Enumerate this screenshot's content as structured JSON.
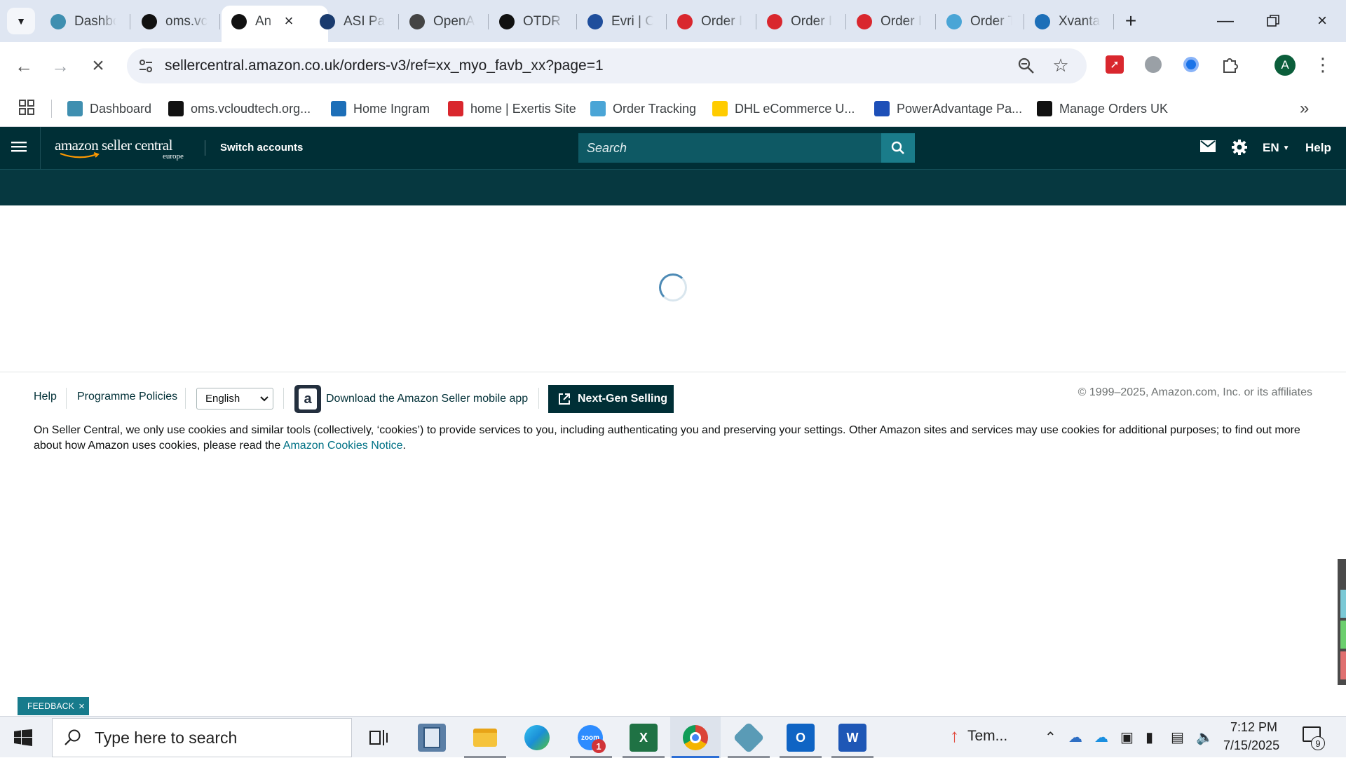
{
  "browser": {
    "tabs": [
      {
        "title": "Dashbo",
        "icon": "dashboard-favicon",
        "color": "#3f8fb0"
      },
      {
        "title": "oms.vc",
        "icon": "oms-favicon",
        "color": "#111111"
      },
      {
        "title": "An",
        "icon": "amazon-favicon",
        "color": "#111111",
        "active": true
      },
      {
        "title": "ASI Par",
        "icon": "asi-favicon",
        "color": "#1a3b6e"
      },
      {
        "title": "OpenA",
        "icon": "openai-favicon",
        "color": "#444444"
      },
      {
        "title": "OTDR (",
        "icon": "openai-favicon",
        "color": "#111111"
      },
      {
        "title": "Evri | Cl",
        "icon": "evri-favicon",
        "color": "#1f4e9c"
      },
      {
        "title": "Order I",
        "icon": "exertis-favicon",
        "color": "#d9272e"
      },
      {
        "title": "Order I",
        "icon": "exertis-favicon",
        "color": "#d9272e"
      },
      {
        "title": "Order I",
        "icon": "exertis-favicon",
        "color": "#d9272e"
      },
      {
        "title": "Order T",
        "icon": "tracking-favicon",
        "color": "#4aa5d6"
      },
      {
        "title": "Xvanta",
        "icon": "xvantage-favicon",
        "color": "#1d6fb8"
      }
    ],
    "url": "sellercentral.amazon.co.uk/orders-v3/ref=xx_myo_favb_xx?page=1",
    "profile_initial": "A",
    "bookmarks": [
      {
        "label": "Dashboard",
        "icon": "dashboard-favicon",
        "color": "#3f8fb0"
      },
      {
        "label": "oms.vcloudtech.org...",
        "icon": "oms-favicon",
        "color": "#111111"
      },
      {
        "label": "Home Ingram",
        "icon": "ingram-favicon",
        "color": "#1d6fb8"
      },
      {
        "label": "home | Exertis Site",
        "icon": "exertis-favicon",
        "color": "#d9272e"
      },
      {
        "label": "Order Tracking",
        "icon": "tracking-favicon",
        "color": "#4aa5d6"
      },
      {
        "label": "DHL eCommerce U...",
        "icon": "dhl-favicon",
        "color": "#ffcc00"
      },
      {
        "label": "PowerAdvantage Pa...",
        "icon": "poweradvantage-favicon",
        "color": "#1d4fb8"
      },
      {
        "label": "Manage Orders UK",
        "icon": "amazon-favicon",
        "color": "#111111"
      }
    ]
  },
  "seller_central": {
    "logo_main": "amazon seller central",
    "logo_sub": "europe",
    "switch_accounts": "Switch accounts",
    "search_placeholder": "Search",
    "language_code": "EN",
    "help": "Help"
  },
  "footer": {
    "help": "Help",
    "programme_policies": "Programme Policies",
    "language_selected": "English",
    "mobile_app": "Download the Amazon Seller mobile app",
    "next_gen": "Next-Gen Selling",
    "copyright": "© 1999–2025, Amazon.com, Inc. or its affiliates",
    "cookie_text": "On Seller Central, we only use cookies and similar tools (collectively, ‘cookies’) to provide services to you, including authenticating you and preserving your settings. Other Amazon sites and services may use cookies for additional purposes; to find out more about how Amazon uses cookies, please read the",
    "cookie_link": "Amazon Cookies Notice",
    "cookie_end": "."
  },
  "feedback": {
    "label": "FEEDBACK",
    "close": "×"
  },
  "taskbar": {
    "search_placeholder": "Type here to search",
    "zoom_badge": "1",
    "weather": "Tem...",
    "time": "7:12 PM",
    "date": "7/15/2025",
    "notification_count": "9"
  }
}
